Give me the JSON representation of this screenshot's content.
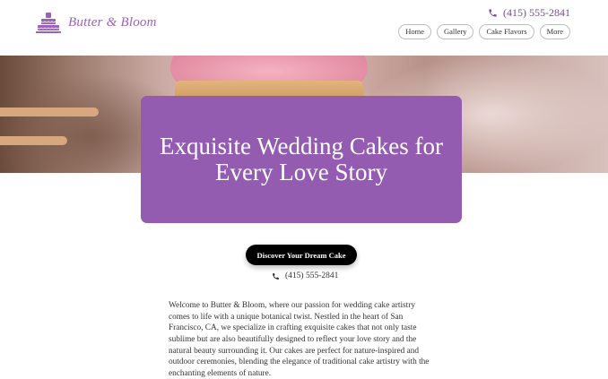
{
  "brand": {
    "name": "Butter & Bloom",
    "accent": "#935cb0"
  },
  "header": {
    "phone": "(415) 555-2841",
    "nav": [
      "Home",
      "Gallery",
      "Cake Flavors",
      "More"
    ]
  },
  "hero": {
    "title": "Exquisite Wedding Cakes for Every Love Story"
  },
  "cta": {
    "label": "Discover Your Dream Cake"
  },
  "contact": {
    "phone": "(415) 555-2841"
  },
  "intro": {
    "text": "Welcome to Butter & Bloom, where our passion for wedding cake artistry comes to life with a unique botanical twist. Nestled in the heart of San Francisco, CA, we specialize in crafting exquisite cakes that not only taste sublime but are also beautifully designed to reflect your love story and the natural beauty surrounding it. Our cakes are perfect for nature-inspired and outdoor ceremonies, blending the elegance of traditional cake artistry with the enchanting elements of nature."
  },
  "icons": {
    "logo": "cake-icon",
    "phone": "phone-icon"
  }
}
